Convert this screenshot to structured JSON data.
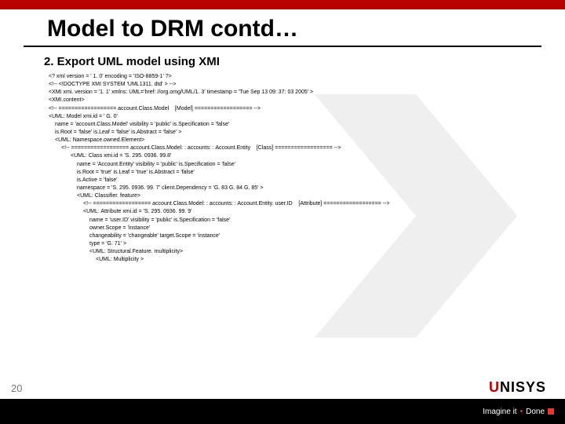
{
  "title": "Model to DRM contd…",
  "subtitle": "2. Export UML model using XMI",
  "code": {
    "l01": "<? xml version = ' 1. 0' encoding = 'ISO-8859-1' ?>",
    "l02": "<!-- <!DOCTYPE XMI SYSTEM 'UML1311. dtd' > -->",
    "l03": "<XMI xmi. version = '1. 1' xmlns: UML='href: //org.omg/UML/1. 3' timestamp = 'Tue Sep 13 09: 37: 03 2005' >",
    "l04": "<XMI.content>",
    "l05": "<!-- ================== account.Class.Model    [Model] ================== -->",
    "l06": "<UML: Model xmi.id = ' G. 0'",
    "l07": "name = 'account.Class.Model' visibility = 'public' is.Specification = 'false'",
    "l08": "is.Root = 'false' is.Leaf = 'false' is.Abstract = 'false' >",
    "l09": "<UML: Namespace.owned.Element>",
    "l10": "<!-- ================== account.Class.Model: : accounts: : Account.Entity    [Class] ================== -->",
    "l11": "<UML: Class xmi.id = 'S. 295. 0936. 99.8'",
    "l12": "name = 'Account.Entity' visibility = 'public' is.Specification = 'false'",
    "l13": "is.Root = 'true' is.Leaf = 'true' is.Abstract = 'false'",
    "l14": "is.Active = 'false'",
    "l15": "namespace = 'S. 295. 0936. 99. 7' client.Dependency = 'G. 83 G. 84 G. 85' >",
    "l16": "<UML: Classifier. feature>",
    "l17": "<!-- ================== account.Class.Model: : accounts: : Account.Entity. user.ID    [Attribute] ================== -->",
    "l18": "<UML: Attribute xmi.id = 'S. 295. 0936. 99. 9'",
    "l19": "name = 'user.ID' visibility = 'public' is.Specification = 'false'",
    "l20": "owner.Scope = 'instance'",
    "l21": "changeability = 'changeable' target.Scope = 'instance'",
    "l22": "type = 'G. 71' >",
    "l23": "<UML: Structural.Feature. multiplicity>",
    "l24": "<UML: Multiplicity >"
  },
  "page": "20",
  "logo": {
    "u": "U",
    "rest": "NISYS"
  },
  "tagline": {
    "imagine": "Imagine it",
    "done": "Done"
  }
}
